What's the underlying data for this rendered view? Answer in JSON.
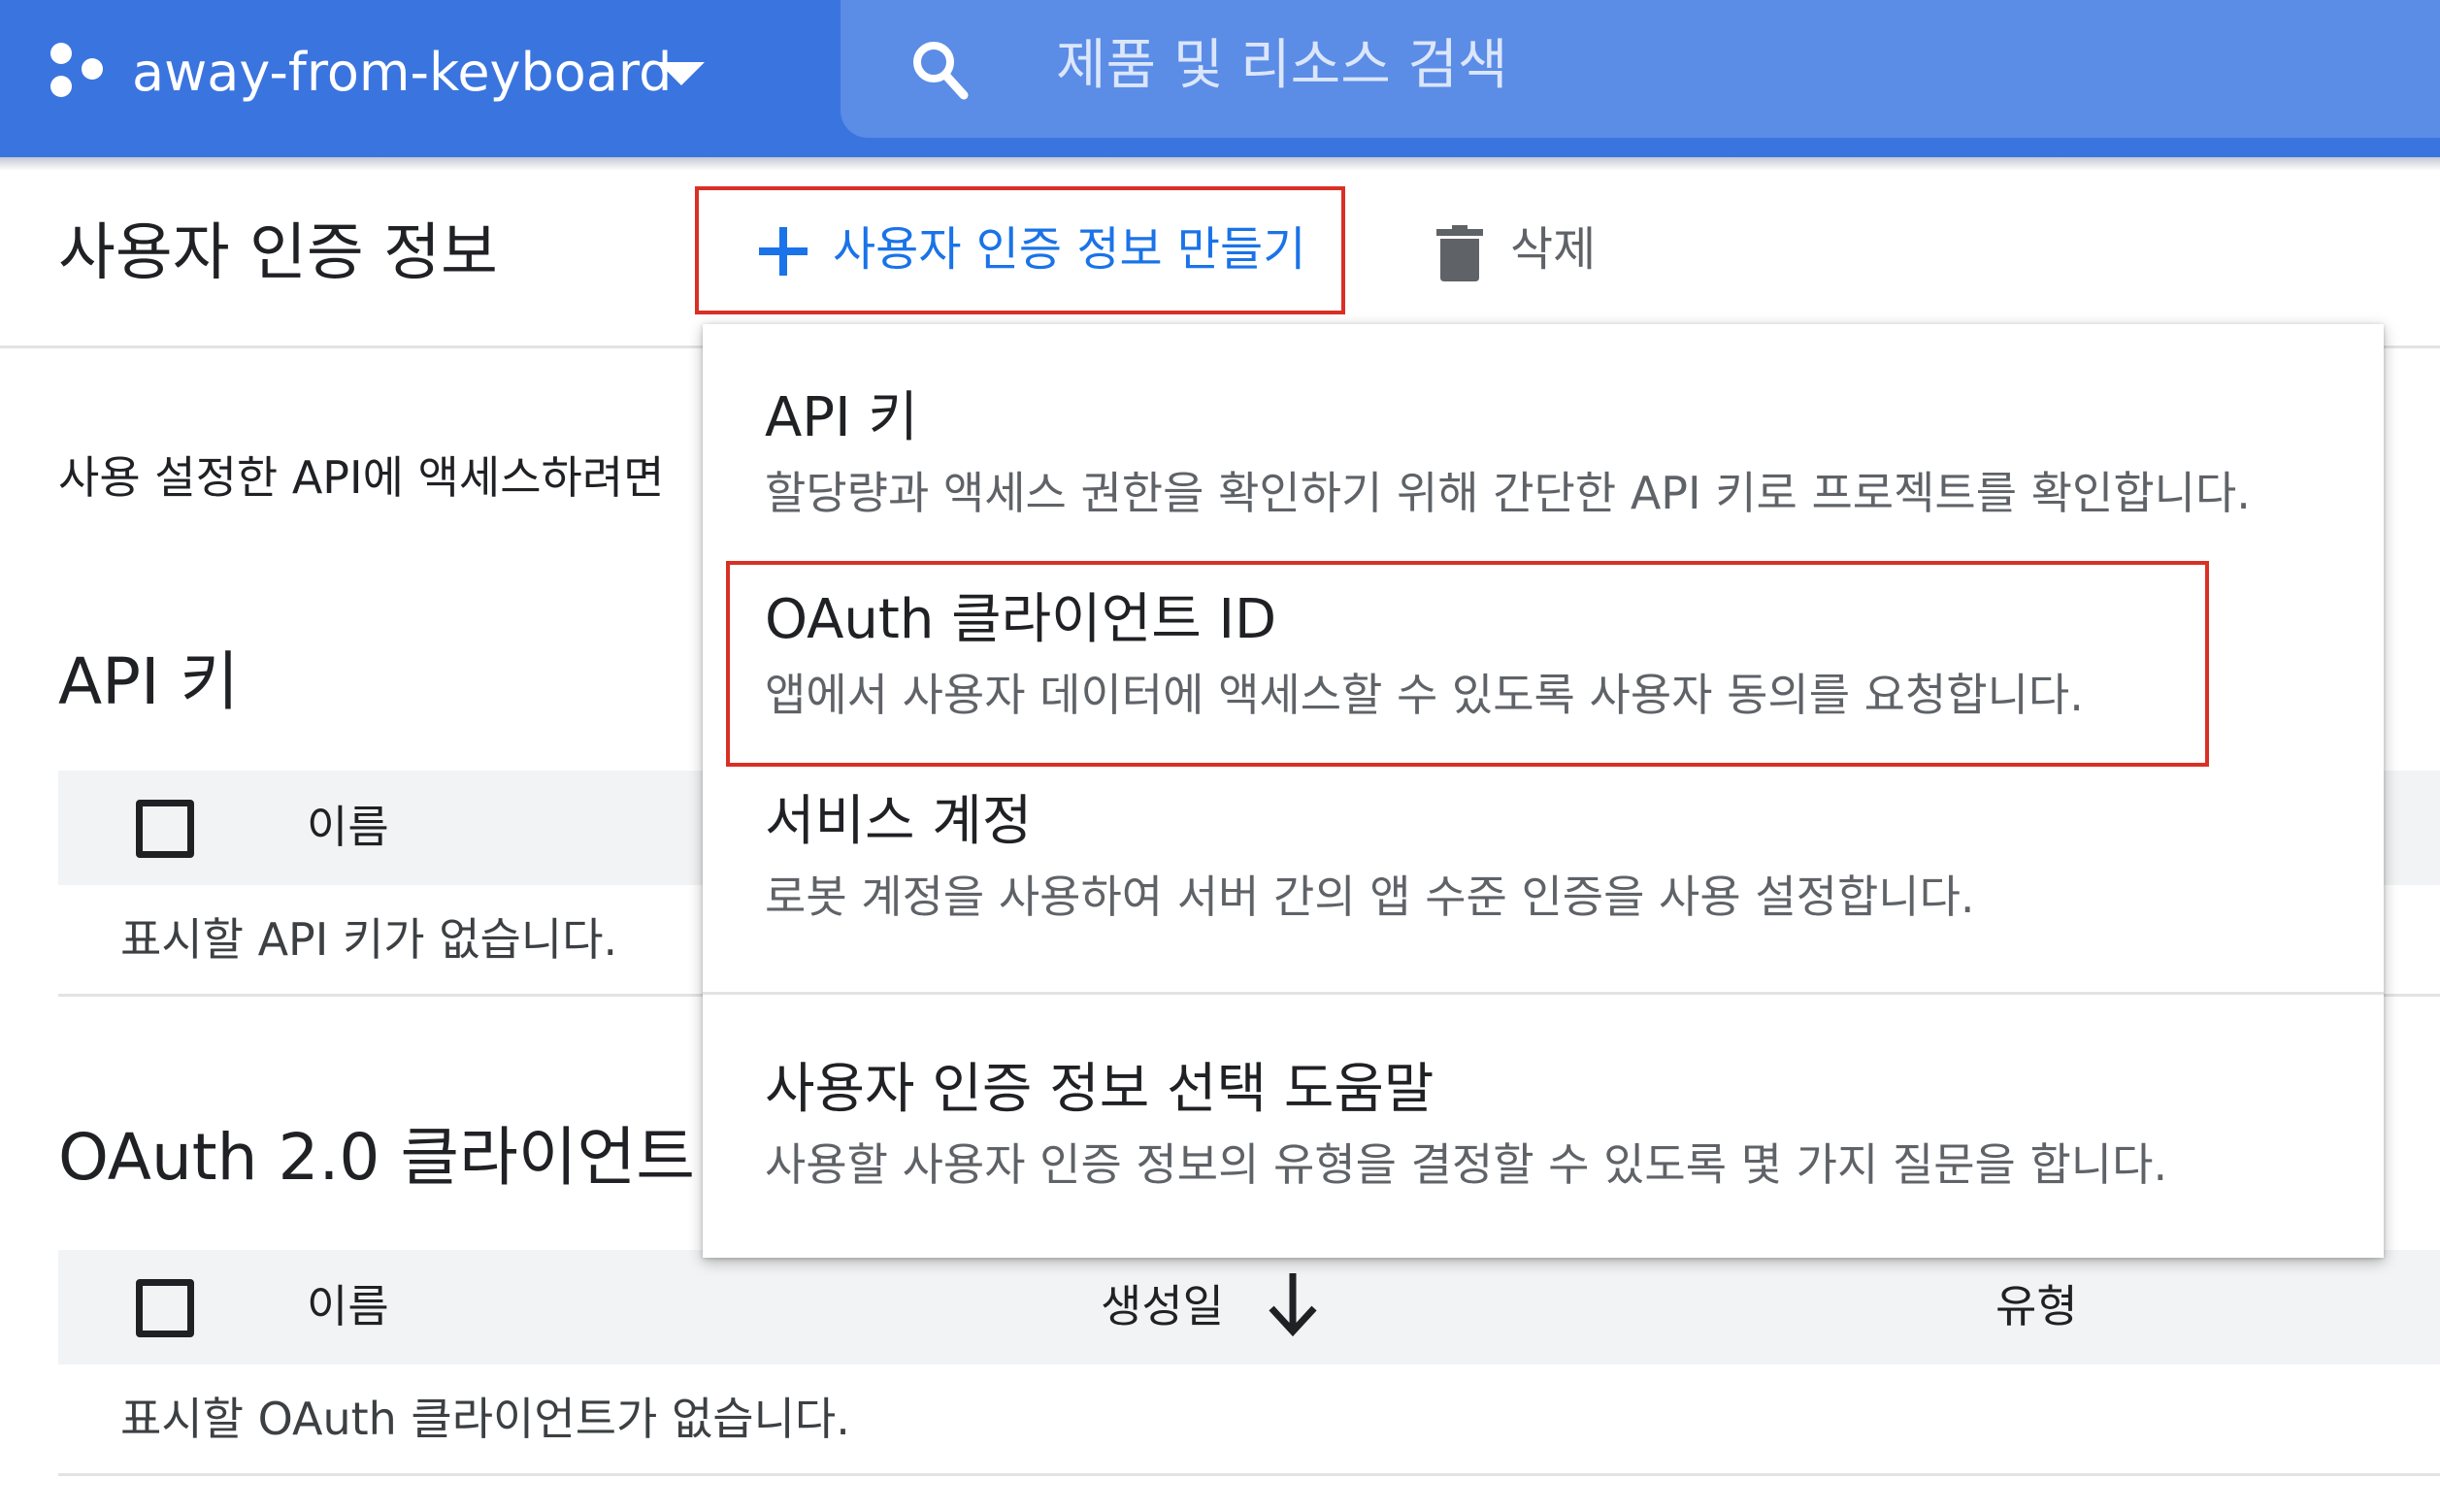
{
  "topbar": {
    "project_name": "away-from-keyboard",
    "search_placeholder": "제품 및 리소스 검색"
  },
  "header": {
    "title": "사용자 인증 정보",
    "create_label": "사용자 인증 정보 만들기",
    "delete_label": "삭제"
  },
  "main": {
    "intro_text": "사용 설정한 API에 액세스하려면",
    "api_keys": {
      "title": "API 키",
      "col_name": "이름",
      "empty_text": "표시할 API 키가 없습니다."
    },
    "oauth": {
      "title": "OAuth 2.0 클라이언트",
      "col_name": "이름",
      "col_created": "생성일",
      "col_type": "유형",
      "empty_text": "표시할 OAuth 클라이언트가 없습니다."
    }
  },
  "menu": {
    "items": [
      {
        "title": "API 키",
        "desc": "할당량과 액세스 권한을 확인하기 위해 간단한 API 키로 프로젝트를 확인합니다."
      },
      {
        "title": "OAuth 클라이언트 ID",
        "desc": "앱에서 사용자 데이터에 액세스할 수 있도록 사용자 동의를 요청합니다."
      },
      {
        "title": "서비스 계정",
        "desc": "로봇 계정을 사용하여 서버 간의 앱 수준 인증을 사용 설정합니다."
      },
      {
        "title": "사용자 인증 정보 선택 도움말",
        "desc": "사용할 사용자 인증 정보의 유형을 결정할 수 있도록 몇 가지 질문을 합니다."
      }
    ]
  },
  "colors": {
    "topbar": "#3a74df",
    "search": "#5b8ce6",
    "accent": "#1a73e8",
    "highlight": "#d93025"
  }
}
